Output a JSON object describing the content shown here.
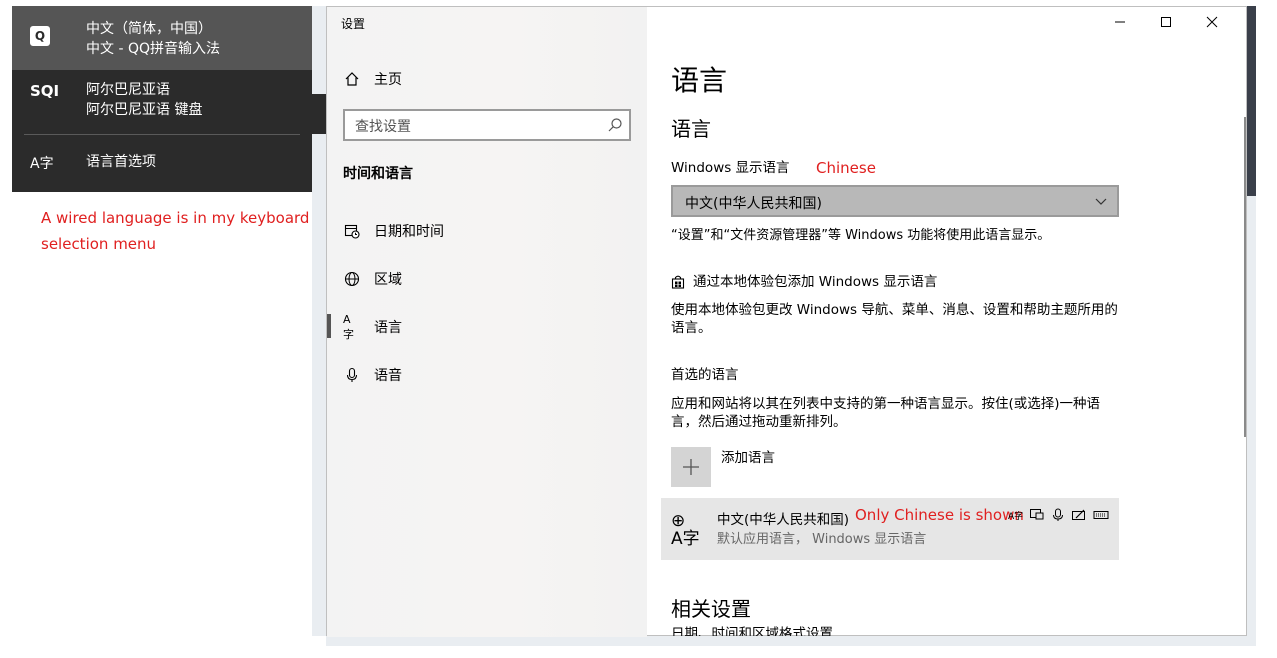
{
  "ime": {
    "items": [
      {
        "icon": "Q",
        "line1": "中文（简体，中国）",
        "line2": "中文 - QQ拼音输入法",
        "selected": true
      },
      {
        "icon": "SQI",
        "line1": "阿尔巴尼亚语",
        "line2": "阿尔巴尼亚语 键盘",
        "selected": false
      }
    ],
    "prefs_icon": "A字",
    "prefs_label": "语言首选项"
  },
  "annotations": {
    "wired": "A wired language is in my keyboard selection menu",
    "chinese": "Chinese",
    "only_chinese": "Only Chinese is shown"
  },
  "window": {
    "title": "设置",
    "controls": {
      "minimize": "−",
      "maximize": "☐",
      "close": "✕"
    }
  },
  "sidebar": {
    "home": "主页",
    "search_placeholder": "查找设置",
    "category": "时间和语言",
    "items": [
      {
        "label": "日期和时间",
        "icon": "calendar-clock-icon"
      },
      {
        "label": "区域",
        "icon": "globe-icon"
      },
      {
        "label": "语言",
        "icon": "language-icon",
        "active": true
      },
      {
        "label": "语音",
        "icon": "microphone-icon"
      }
    ]
  },
  "main": {
    "page_title": "语言",
    "section_title": "语言",
    "display_lang_label": "Windows 显示语言",
    "display_lang_value": "中文(中华人民共和国)",
    "display_lang_desc": "“设置”和“文件资源管理器”等 Windows 功能将使用此语言显示。",
    "add_pack_link": "通过本地体验包添加 Windows 显示语言",
    "pack_desc": "使用本地体验包更改 Windows 导航、菜单、消息、设置和帮助主题所用的语言。",
    "preferred_title": "首选的语言",
    "preferred_desc": "应用和网站将以其在列表中支持的第一种语言显示。按住(或选择)一种语言，然后通过拖动重新排列。",
    "add_language": "添加语言",
    "lang_entry": {
      "name": "中文(中华人民共和国)",
      "sub": "默认应用语言， Windows 显示语言"
    },
    "related_title": "相关设置",
    "related_link": "日期、时间和区域格式设置"
  }
}
